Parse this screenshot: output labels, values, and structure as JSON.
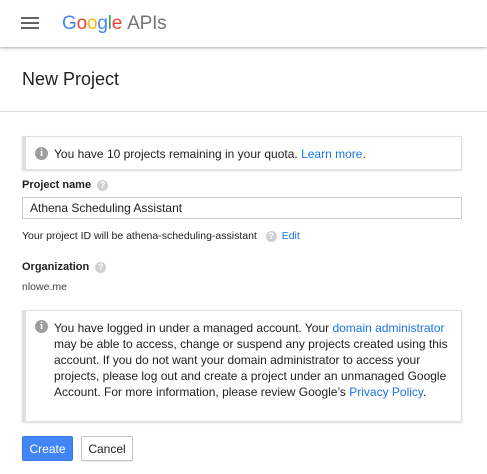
{
  "header": {
    "logo_letters": [
      "G",
      "o",
      "o",
      "g",
      "l",
      "e"
    ],
    "logo_suffix": "APIs",
    "menu_icon": "hamburger-menu-icon"
  },
  "page": {
    "title": "New Project"
  },
  "quota": {
    "message": "You have 10 projects remaining in your quota.",
    "link_text": "Learn more",
    "suffix": "."
  },
  "project_name": {
    "label": "Project name",
    "value": "Athena Scheduling Assistant",
    "id_prefix": "Your project ID will be",
    "id_value": "athena-scheduling-assistant",
    "edit_label": "Edit"
  },
  "organization": {
    "label": "Organization",
    "value": "nlowe.me"
  },
  "managed_notice": {
    "part1": "You have logged in under a managed account. Your ",
    "link1": "domain administrator",
    "part2": " may be able to access, change or suspend any projects created using this account. If you do not want your domain administrator to access your projects, please log out and create a project under an unmanaged Google Account. For more information, please review Google’s ",
    "link2": "Privacy Policy",
    "part3": "."
  },
  "actions": {
    "create_label": "Create",
    "cancel_label": "Cancel"
  },
  "colors": {
    "primary": "#4285f4",
    "link": "#1a73e8",
    "logo": [
      "#4285f4",
      "#ea4335",
      "#fbbc05",
      "#4285f4",
      "#34a853",
      "#ea4335"
    ]
  }
}
